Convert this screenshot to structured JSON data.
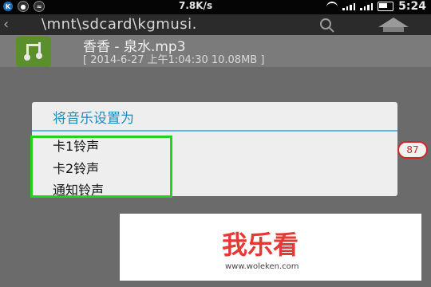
{
  "status_bar": {
    "speed": "7.8K/s",
    "time": "5:24",
    "left_icons": [
      "k-badge-icon",
      "notification-icon",
      "network-icon"
    ]
  },
  "path_bar": {
    "path": "\\mnt\\sdcard\\kgmusi.",
    "icons": [
      "back-chevron-icon",
      "search-icon",
      "home-icon"
    ]
  },
  "file": {
    "name": "香香 - 泉水.mp3",
    "meta": "[ 2014-6-27 上午1:04:30 10.08MB ]"
  },
  "dialog": {
    "title": "将音乐设置为",
    "options": [
      "卡1铃声",
      "卡2铃声",
      "通知铃声"
    ]
  },
  "badge": {
    "count": "87"
  },
  "watermark": {
    "logo_text": "我乐看",
    "url": "www.woleken.com"
  },
  "colors": {
    "dialog_accent": "#1e8bbd",
    "highlight": "#25d31e",
    "badge": "#d42424"
  }
}
